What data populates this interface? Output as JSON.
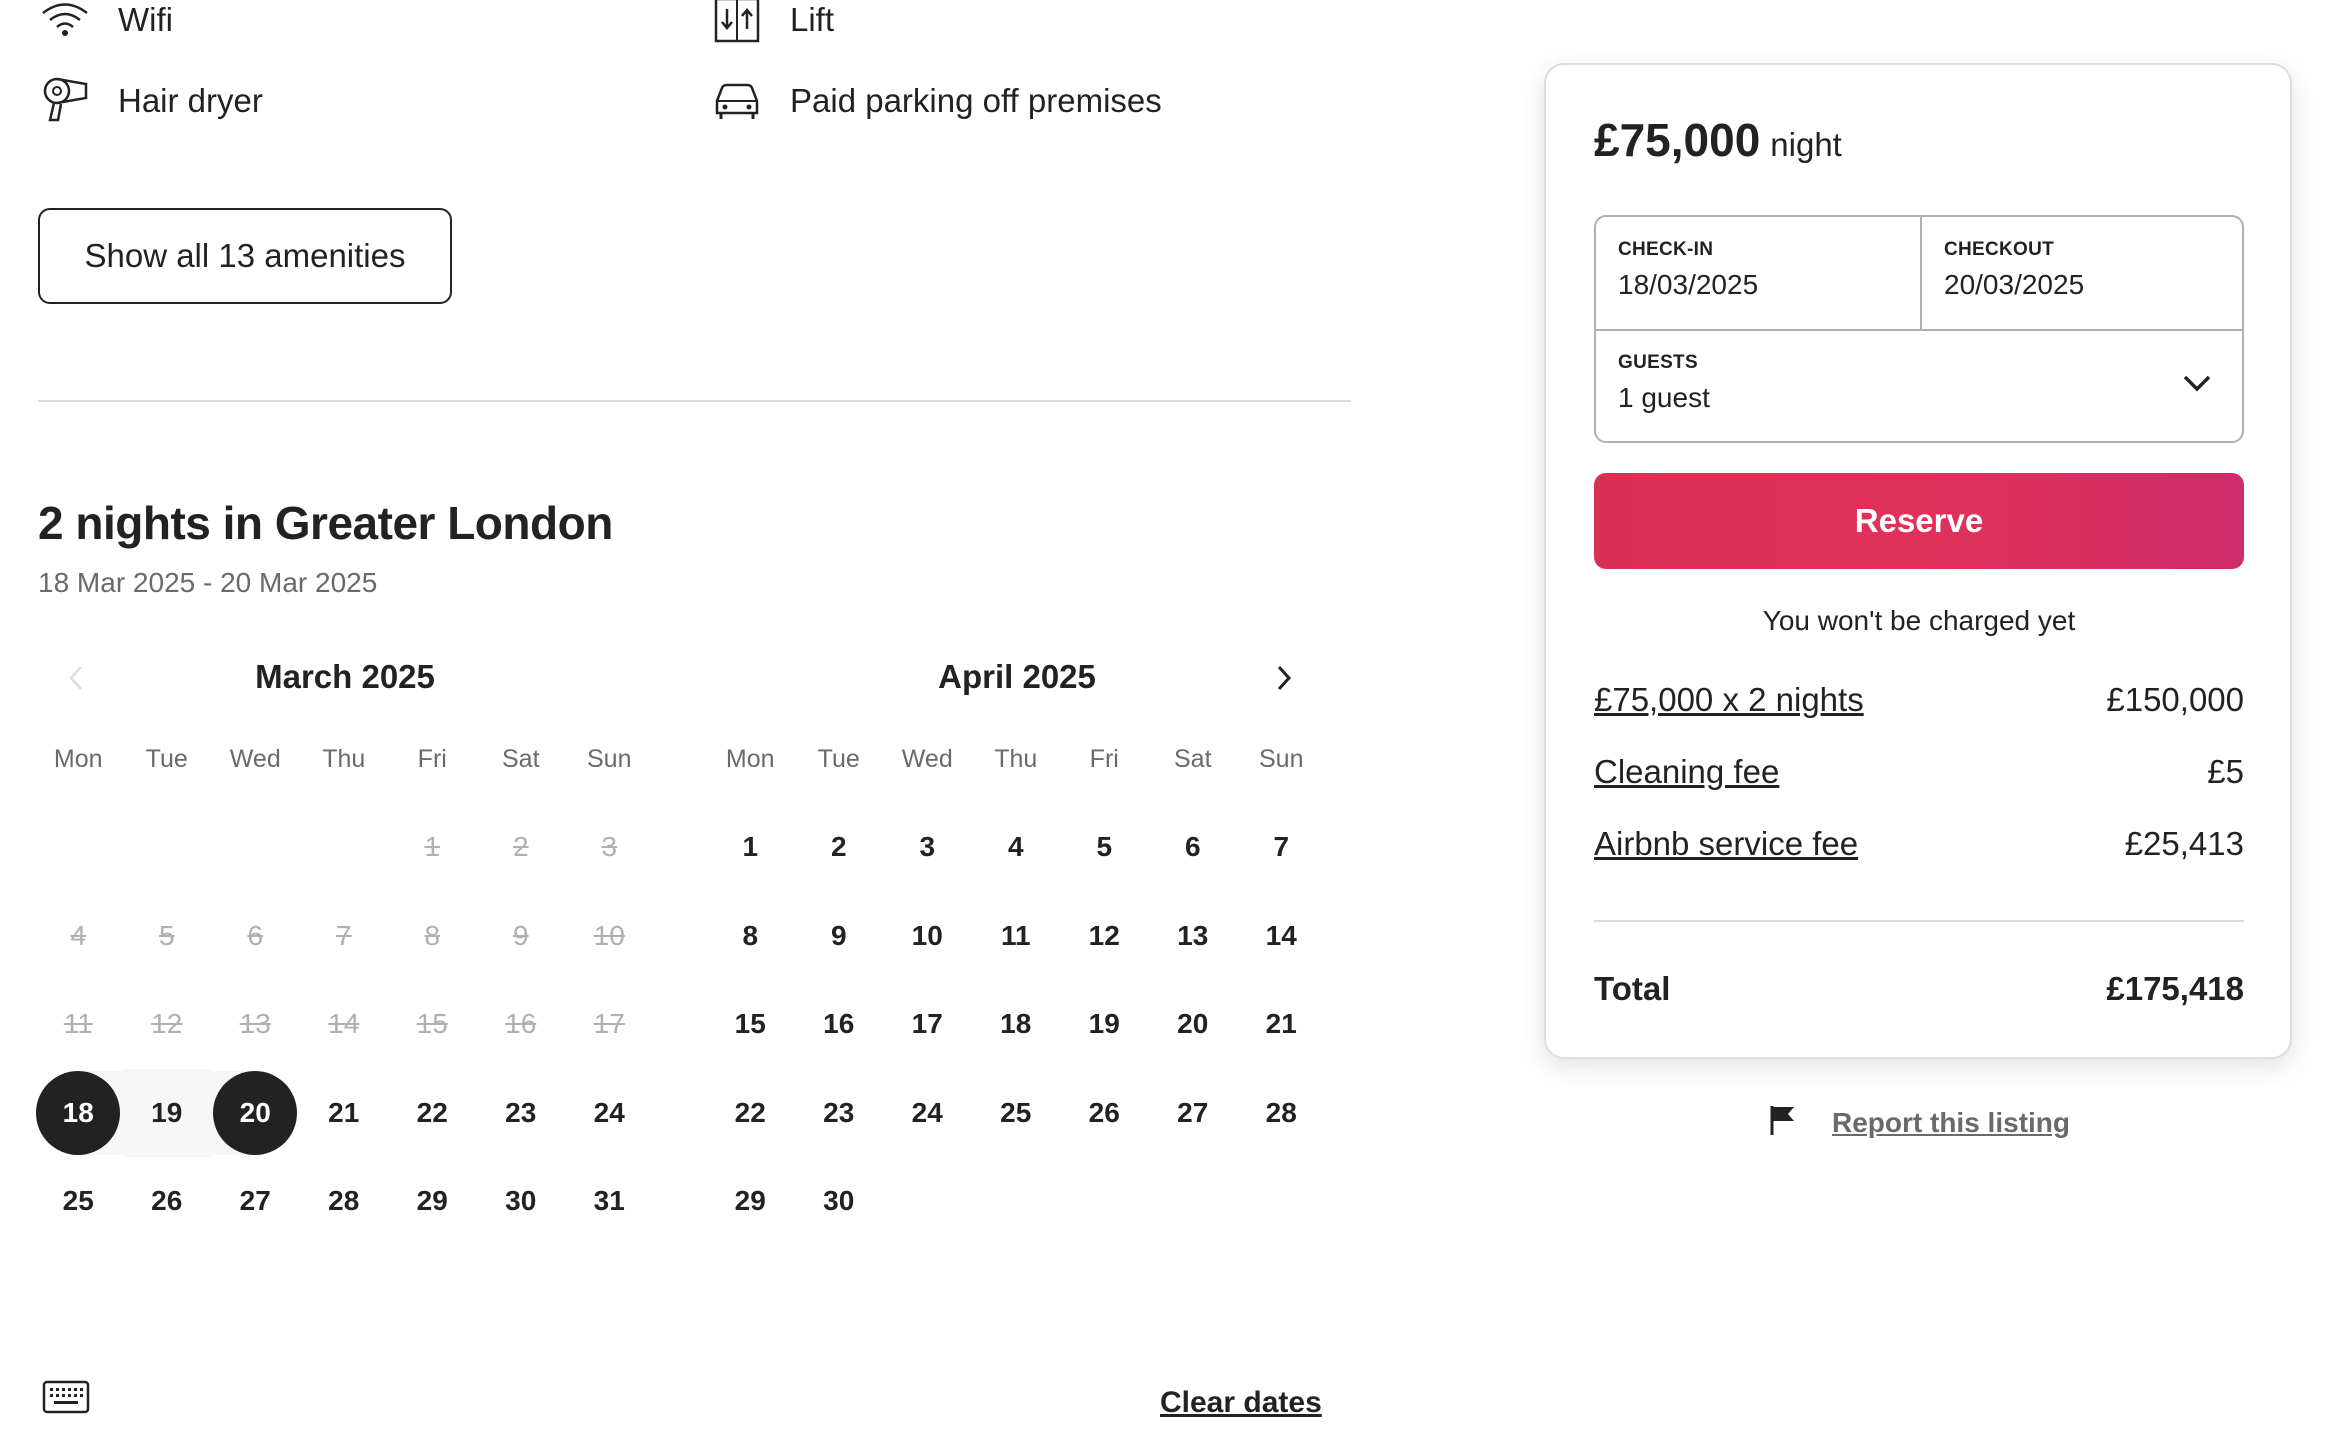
{
  "amenities": [
    {
      "label": "Wifi",
      "icon": "wifi-icon"
    },
    {
      "label": "Lift",
      "icon": "lift-icon"
    },
    {
      "label": "Hair dryer",
      "icon": "hair-dryer-icon"
    },
    {
      "label": "Paid parking off premises",
      "icon": "car-icon"
    }
  ],
  "show_amenities_label": "Show all 13 amenities",
  "stay": {
    "title": "2 nights in Greater London",
    "dates": "18 Mar 2025 - 20 Mar 2025"
  },
  "calendar": {
    "weekdays": [
      "Mon",
      "Tue",
      "Wed",
      "Thu",
      "Fri",
      "Sat",
      "Sun"
    ],
    "months": [
      {
        "title": "March 2025",
        "first_weekday": 5,
        "days": 31,
        "disabled_through": 17,
        "selected": [
          18,
          20
        ],
        "in_range": [
          19
        ]
      },
      {
        "title": "April 2025",
        "first_weekday": 1,
        "days": 30,
        "disabled_through": 0,
        "selected": [],
        "in_range": []
      }
    ],
    "clear_label": "Clear dates"
  },
  "booking": {
    "price": "£75,000",
    "price_unit": "night",
    "checkin_label": "CHECK-IN",
    "checkin_value": "18/03/2025",
    "checkout_label": "CHECKOUT",
    "checkout_value": "20/03/2025",
    "guests_label": "GUESTS",
    "guests_value": "1 guest",
    "reserve_label": "Reserve",
    "note": "You won't be charged yet",
    "lines": [
      {
        "label": "£75,000 x 2 nights",
        "value": "£150,000"
      },
      {
        "label": "Cleaning fee",
        "value": "£5"
      },
      {
        "label": "Airbnb service fee",
        "value": "£25,413"
      }
    ],
    "total_label": "Total",
    "total_value": "£175,418"
  },
  "report_label": "Report this listing",
  "colors": {
    "accent": "#e0315a",
    "text": "#222222",
    "muted": "#6a6a6a"
  }
}
